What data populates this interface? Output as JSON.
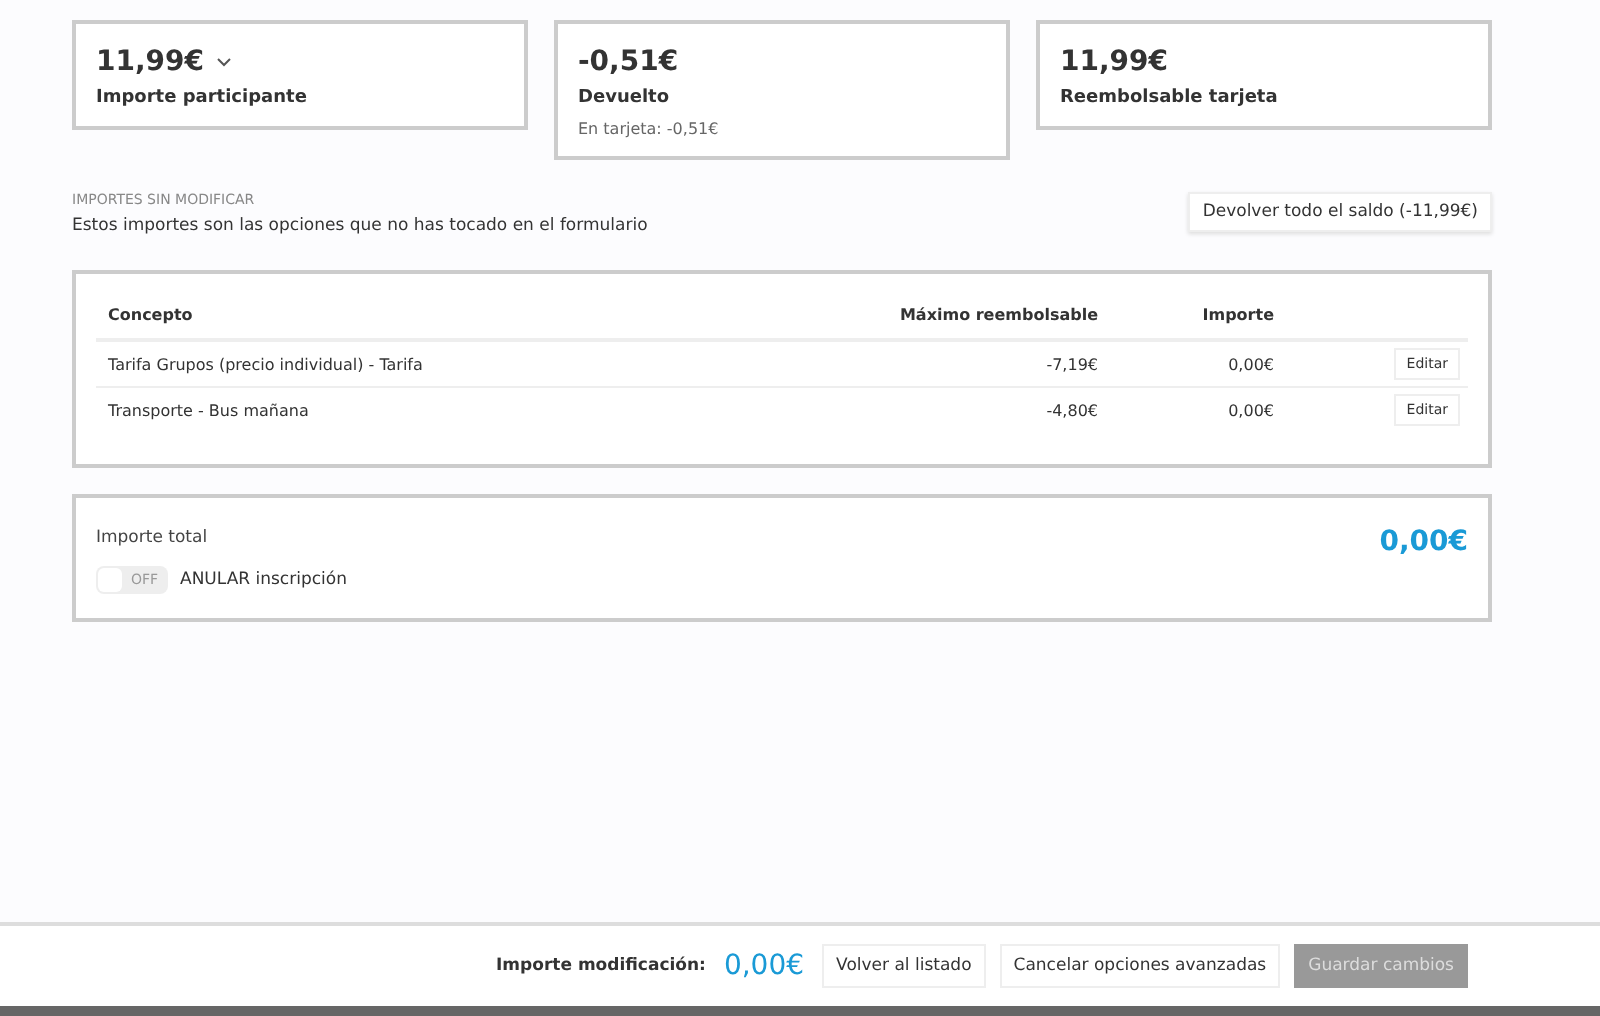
{
  "summary_cards": [
    {
      "amount": "11,99€",
      "label": "Importe participante",
      "dropdown": true
    },
    {
      "amount": "-0,51€",
      "label": "Devuelto",
      "note": "En tarjeta: -0,51€"
    },
    {
      "amount": "11,99€",
      "label": "Reembolsable tarjeta"
    }
  ],
  "unmodified": {
    "heading": "IMPORTES SIN MODIFICAR",
    "description": "Estos importes son las opciones que no has tocado en el formulario",
    "return_button": "Devolver todo el saldo (-11,99€)"
  },
  "table": {
    "columns": [
      "Concepto",
      "Máximo reembolsable",
      "Importe"
    ],
    "rows": [
      {
        "concept": "Tarifa Grupos (precio individual) - Tarifa",
        "max": "-7,19€",
        "amount": "0,00€",
        "action": "Editar"
      },
      {
        "concept": "Transporte - Bus mañana",
        "max": "-4,80€",
        "amount": "0,00€",
        "action": "Editar"
      }
    ]
  },
  "total": {
    "label": "Importe total",
    "value": "0,00€",
    "toggle": {
      "on": false,
      "state_text": "OFF",
      "label": "ANULAR inscripción"
    }
  },
  "footer": {
    "label": "Importe modificación:",
    "value": "0,00€",
    "buttons": [
      {
        "label": "Volver al listado",
        "disabled": false
      },
      {
        "label": "Cancelar opciones avanzadas",
        "disabled": false
      },
      {
        "label": "Guardar cambios",
        "disabled": true
      }
    ]
  }
}
